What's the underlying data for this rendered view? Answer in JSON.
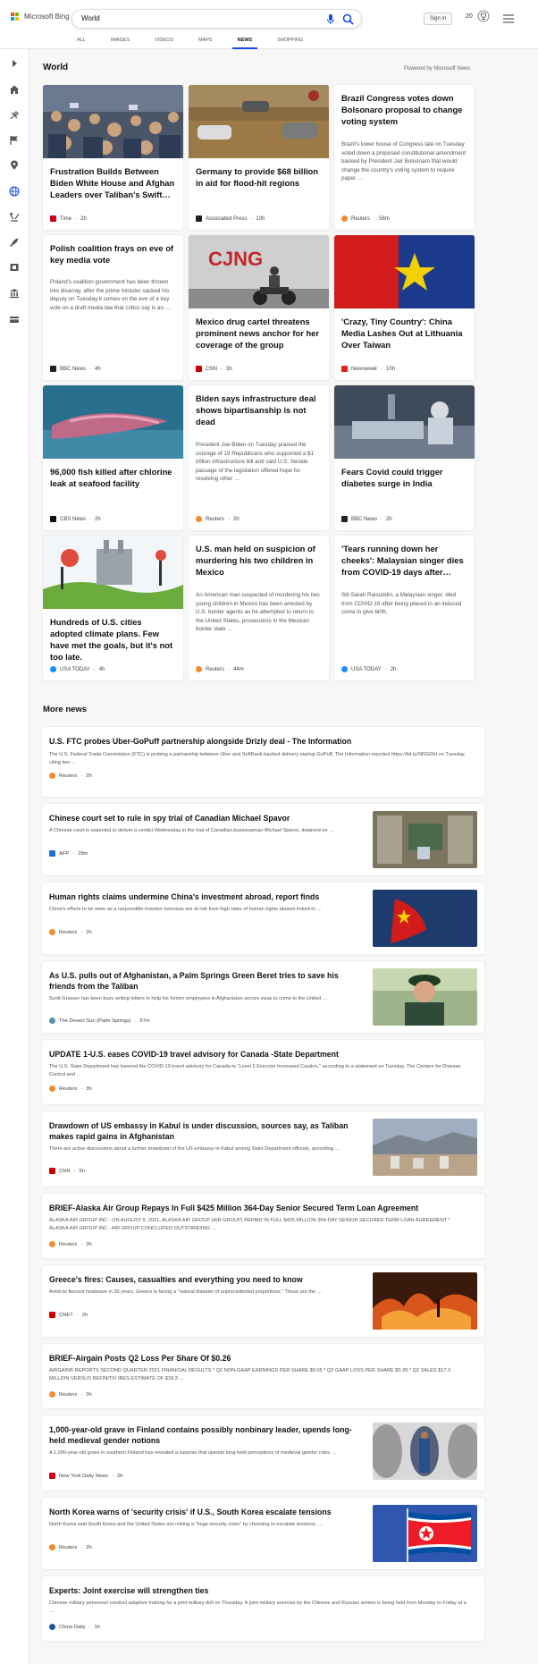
{
  "header": {
    "brand": "Microsoft Bing",
    "search_value": "World",
    "signin_label": "Sign in",
    "rewards_points": "20",
    "tabs": [
      "ALL",
      "IMAGES",
      "VIDEOS",
      "MAPS",
      "NEWS",
      "SHOPPING"
    ],
    "active_tab": "NEWS"
  },
  "sidebar": {
    "icons": [
      "chevron-right-icon",
      "home-icon",
      "tools-icon",
      "flag-icon",
      "location-pin-icon",
      "globe-icon",
      "scales-icon",
      "rocket-icon",
      "film-icon",
      "bank-icon",
      "card-icon"
    ]
  },
  "world": {
    "title": "World",
    "powered": "Powered by Microsoft News",
    "cards": [
      {
        "headline": "Frustration Builds Between Biden White House and Afghan Leaders over Taliban's Swift…",
        "source": "Time",
        "age": "2h",
        "fav_color": "#d0021b",
        "image": "crowd"
      },
      {
        "headline": "Germany to provide $68 billion in aid for flood-hit regions",
        "source": "Associated Press",
        "age": "10h",
        "fav_color": "#222222",
        "image": "flood"
      },
      {
        "headline": "Brazil Congress votes down Bolsonaro proposal to change voting system",
        "summary": "Brazil's lower house of Congress late on Tuesday voted down a proposed constitutional amendment backed by President Jair Bolsonaro that would change the country's voting system to require paper …",
        "source": "Reuters",
        "age": "58m",
        "fav_color": "#f28a30"
      },
      {
        "headline": "Polish coalition frays on eve of key media vote",
        "summary": "Poland's coalition government has been thrown into disarray, after the prime minister sacked his deputy on Tuesday.It comes on the eve of a key vote on a draft media law that critics say is an …",
        "source": "BBC News",
        "age": "4h",
        "fav_color": "#222222"
      },
      {
        "headline": "Mexico drug cartel threatens prominent news anchor for her coverage of the group",
        "source": "CNN",
        "age": "3h",
        "fav_color": "#cc0000",
        "image": "graffiti"
      },
      {
        "headline": "'Crazy, Tiny Country': China Media Lashes Out at Lithuania Over Taiwan",
        "source": "Newsweek",
        "age": "10h",
        "fav_color": "#e2231a",
        "image": "flags"
      },
      {
        "headline": "96,000 fish killed after chlorine leak at seafood facility",
        "source": "CBS News",
        "age": "2h",
        "fav_color": "#111111",
        "image": "fish"
      },
      {
        "headline": "Biden says infrastructure deal shows bipartisanship is not dead",
        "summary": "President Joe Biden on Tuesday praised the courage of 19 Republicans who supported a $1 trillion infrastructure bill and said U.S. Senate passage of the legislation offered hope for resolving other …",
        "source": "Reuters",
        "age": "2h",
        "fav_color": "#f28a30"
      },
      {
        "headline": "Fears Covid could trigger diabetes surge in India",
        "source": "BBC News",
        "age": "2h",
        "fav_color": "#222222",
        "image": "hospital"
      },
      {
        "headline": "Hundreds of U.S. cities adopted climate plans. Few have met the goals, but it's not too late.",
        "source": "USA TODAY",
        "age": "4h",
        "fav_color": "#1a8cff",
        "image": "climate"
      },
      {
        "headline": "U.S. man held on suspicion of murdering his two children in Mexico",
        "summary": "An American man suspected of murdering his two young children in Mexico has been arrested by U.S. border agents as he attempted to return to the United States, prosecutors in the Mexican border state …",
        "source": "Reuters",
        "age": "44m",
        "fav_color": "#f28a30"
      },
      {
        "headline": "'Tears running down her cheeks': Malaysian singer dies from COVID-19 days after…",
        "summary": "Siti Sarah Raisuddin, a Malaysian singer, died from COVID-19 after being placed in an induced coma to give birth.",
        "source": "USA TODAY",
        "age": "2h",
        "fav_color": "#1a8cff"
      }
    ]
  },
  "more_news": {
    "title": "More news",
    "items": [
      {
        "headline": "U.S. FTC probes Uber-GoPuff partnership alongside Drizly deal - The Information",
        "summary": "The U.S. Federal Trade Commission (FTC) is probing a partnership between Uber and SoftBank-backed delivery startup GoPuff, The Information reported https://bit.ly/3lRG0IH on Tuesday, citing two …",
        "source": "Reuters",
        "age": "2h",
        "fav_color": "#f28a30"
      },
      {
        "headline": "Chinese court set to rule in spy trial of Canadian Michael Spavor",
        "summary": "A Chinese court is expected to deliver a verdict Wednesday in the trial of Canadian businessman Michael Spavor, detained on …",
        "source": "AFP",
        "age": "28m",
        "fav_color": "#1a6fd6",
        "thumb": "gate"
      },
      {
        "headline": "Human rights claims undermine China's investment abroad, report finds",
        "summary": "China's efforts to be seen as a responsible investor overseas are at risk from high rates of human rights abuses linked to …",
        "source": "Reuters",
        "age": "2h",
        "fav_color": "#f28a30",
        "thumb": "china-flag"
      },
      {
        "headline": "As U.S. pulls out of Afghanistan, a Palm Springs Green Beret tries to save his friends from the Taliban",
        "summary": "Scott Grasser has been busy writing letters to help his former employees in Afghanistan secure visas to come to the United …",
        "source": "The Desert Sun (Palm Springs)",
        "age": "57m",
        "fav_color": "#5a8fa8",
        "thumb": "beret"
      },
      {
        "headline": "UPDATE 1-U.S. eases COVID-19 travel advisory for Canada -State Department",
        "summary": "The U.S. State Department has lowered the COVID-19 travel advisory for Canada to \"Level 2 Exercise Increased Caution,\" according to a statement on Tuesday. The Centers for Disease Control and …",
        "source": "Reuters",
        "age": "3h",
        "fav_color": "#f28a30"
      },
      {
        "headline": "Drawdown of US embassy in Kabul is under discussion, sources say, as Taliban makes rapid gains in Afghanistan",
        "summary": "There are active discussions about a further drawdown of the US embassy in Kabul among State Department officials, according …",
        "source": "CNN",
        "age": "5h",
        "fav_color": "#cc0000",
        "thumb": "kabul"
      },
      {
        "headline": "BRIEF-Alaska Air Group Repays In Full $425 Million 364-Day Senior Secured Term Loan Agreement",
        "summary": "ALASKA AIR GROUP INC - ON AUGUST 9, 2021, ALASKA AIR GROUP (AIR GROUP) REPAID IN FULL $425 MILLION 364-DAY SENIOR SECURED TERM LOAN AGREEMENT * ALASKA AIR GROUP INC - AIR GROUP CONCLUDED OUTSTANDING …",
        "source": "Reuters",
        "age": "3h",
        "fav_color": "#f28a30"
      },
      {
        "headline": "Greece's fires: Causes, casualties and everything you need to know",
        "summary": "Amid its fiercest heatwave in 30 years, Greece is facing a \"natural disaster of unprecedented proportions.\" Those are the …",
        "source": "CNET",
        "age": "2h",
        "fav_color": "#d00000",
        "thumb": "fire"
      },
      {
        "headline": "BRIEF-Airgain Posts Q2 Loss Per Share Of $0.26",
        "summary": "AIRGAIN® REPORTS SECOND QUARTER 2021 FINANCIAL RESULTS * Q2 NON-GAAP EARNINGS PER SHARE $0.05 * Q2 GAAP LOSS PER SHARE $0.26 * Q2 SALES $17.3 MILLION VERSUS REFINITIV IBES ESTIMATE OF $18.3 …",
        "source": "Reuters",
        "age": "3h",
        "fav_color": "#f28a30"
      },
      {
        "headline": "1,000-year-old grave in Finland contains possibly nonbinary leader, upends long-held medieval gender notions",
        "summary": "A 1,000-year-old grave in southern Finland has revealed a surprise that upends long-held perceptions of medieval gender roles …",
        "source": "New York Daily News",
        "age": "2h",
        "fav_color": "#d0021b",
        "thumb": "grave"
      },
      {
        "headline": "North Korea warns of 'security crisis' if U.S., South Korea escalate tensions",
        "summary": "North Korea said South Korea and the United States are risking a \"huge security crisis\" by choosing to escalate tensions, …",
        "source": "Reuters",
        "age": "2h",
        "fav_color": "#f28a30",
        "thumb": "nk-flag"
      },
      {
        "headline": "Experts: Joint exercise will strengthen ties",
        "summary": "Chinese military personnel conduct adaptive training for a joint military drill on Thursday. A joint military exercise by the Chinese and Russian armies is being held from Monday to Friday at a …",
        "source": "China Daily",
        "age": "1h",
        "fav_color": "#2255aa"
      }
    ]
  },
  "colors": {
    "accent": "#174ae4",
    "brand_red": "#f25022",
    "brand_green": "#7fba00",
    "brand_blue": "#00a4ef",
    "brand_yellow": "#ffb900"
  }
}
